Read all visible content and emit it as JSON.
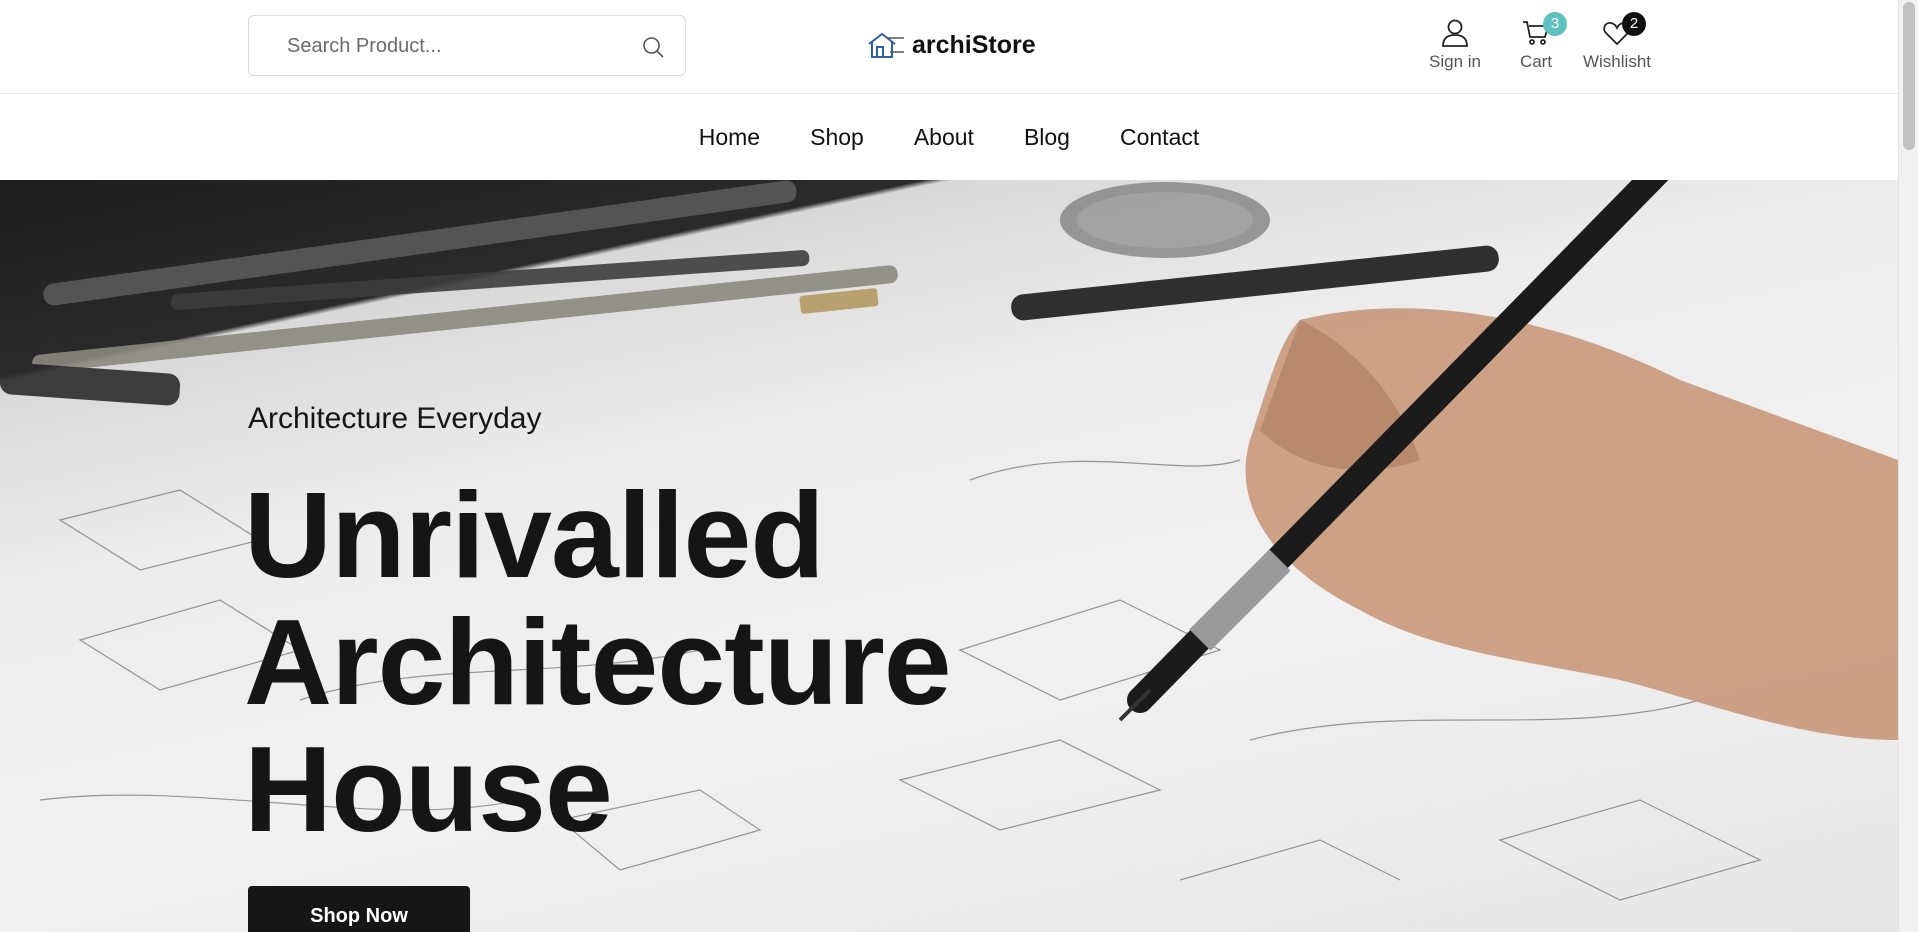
{
  "search": {
    "placeholder": "Search Product..."
  },
  "logo": {
    "text": "archiStore"
  },
  "header_actions": {
    "signin_label": "Sign in",
    "cart_label": "Cart",
    "cart_count": "3",
    "wishlist_label": "Wishlisht",
    "wishlist_count": "2"
  },
  "nav": {
    "items": [
      "Home",
      "Shop",
      "About",
      "Blog",
      "Contact"
    ]
  },
  "hero": {
    "subtitle": "Architecture Everyday",
    "title_lines": [
      "Unrivalled",
      "Architecture",
      "House"
    ],
    "button_label": "Shop Now"
  },
  "colors": {
    "accent_teal": "#5fc1bd",
    "dark": "#161616",
    "logo_blue": "#2f5fa6"
  },
  "icons": [
    "search-icon",
    "logo-house-icon",
    "user-icon",
    "cart-icon",
    "heart-icon"
  ]
}
